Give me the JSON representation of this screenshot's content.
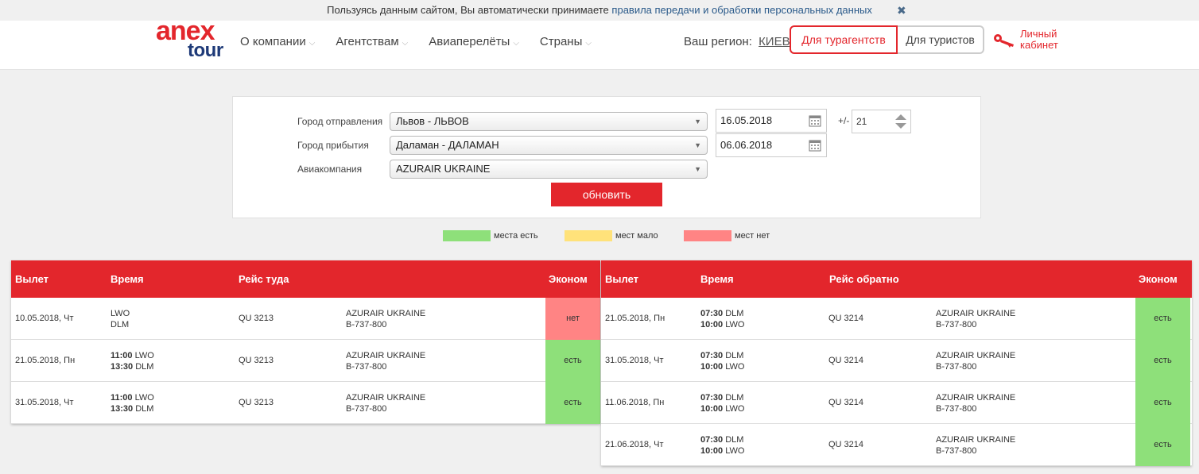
{
  "cookie": {
    "text": "Пользуясь данным сайтом, Вы автоматически принимаете",
    "link": "правила передачи и обработки персональных данных",
    "close": "✖"
  },
  "header": {
    "logo_top": "anex",
    "logo_bottom": "tour",
    "nav": [
      "О компании",
      "Агентствам",
      "Авиаперелёты",
      "Страны"
    ],
    "region_label": "Ваш регион:",
    "region_city": "КИЕВ",
    "btn_agents": "Для турагентств",
    "btn_tourists": "Для туристов",
    "cabinet_line1": "Личный",
    "cabinet_line2": "кабинет",
    "brand_red": "#e3262c",
    "brand_blue": "#1e3a78"
  },
  "search": {
    "departure_label": "Город отправления",
    "departure_value": "Львов - ЛЬВОВ",
    "arrival_label": "Город прибытия",
    "arrival_value": "Даламан - ДАЛАМАН",
    "airline_label": "Авиакомпания",
    "airline_value": "AZURAIR UKRAINE",
    "date_from": "16.05.2018",
    "date_to": "06.06.2018",
    "range_label": "+/-",
    "range_value": "21",
    "update_button": "обновить",
    "calendar_icon": "calendar-icon"
  },
  "legend": [
    {
      "label": "места есть",
      "color": "#8ee07a"
    },
    {
      "label": "мест мало",
      "color": "#ffe27a"
    },
    {
      "label": "мест нет",
      "color": "#ff8484"
    }
  ],
  "outbound": {
    "headers": {
      "date": "Вылет",
      "time": "Время",
      "flight": "Рейс туда",
      "eco": "Эконом"
    },
    "rows": [
      {
        "date": "10.05.2018, Чт",
        "t1": "",
        "p1": "LWO",
        "t2": "",
        "p2": "DLM",
        "flight": "QU 3213",
        "airline": "AZURAIR UKRAINE",
        "plane": "B-737-800",
        "eco": "нет",
        "status": "red"
      },
      {
        "date": "21.05.2018, Пн",
        "t1": "11:00",
        "p1": "LWO",
        "t2": "13:30",
        "p2": "DLM",
        "flight": "QU 3213",
        "airline": "AZURAIR UKRAINE",
        "plane": "B-737-800",
        "eco": "есть",
        "status": "green"
      },
      {
        "date": "31.05.2018, Чт",
        "t1": "11:00",
        "p1": "LWO",
        "t2": "13:30",
        "p2": "DLM",
        "flight": "QU 3213",
        "airline": "AZURAIR UKRAINE",
        "plane": "B-737-800",
        "eco": "есть",
        "status": "green"
      }
    ]
  },
  "inbound": {
    "headers": {
      "date": "Вылет",
      "time": "Время",
      "flight": "Рейс обратно",
      "eco": "Эконом"
    },
    "rows": [
      {
        "date": "21.05.2018, Пн",
        "t1": "07:30",
        "p1": "DLM",
        "t2": "10:00",
        "p2": "LWO",
        "flight": "QU 3214",
        "airline": "AZURAIR UKRAINE",
        "plane": "B-737-800",
        "eco": "есть",
        "status": "green"
      },
      {
        "date": "31.05.2018, Чт",
        "t1": "07:30",
        "p1": "DLM",
        "t2": "10:00",
        "p2": "LWO",
        "flight": "QU 3214",
        "airline": "AZURAIR UKRAINE",
        "plane": "B-737-800",
        "eco": "есть",
        "status": "green"
      },
      {
        "date": "11.06.2018, Пн",
        "t1": "07:30",
        "p1": "DLM",
        "t2": "10:00",
        "p2": "LWO",
        "flight": "QU 3214",
        "airline": "AZURAIR UKRAINE",
        "plane": "B-737-800",
        "eco": "есть",
        "status": "green"
      },
      {
        "date": "21.06.2018, Чт",
        "t1": "07:30",
        "p1": "DLM",
        "t2": "10:00",
        "p2": "LWO",
        "flight": "QU 3214",
        "airline": "AZURAIR UKRAINE",
        "plane": "B-737-800",
        "eco": "есть",
        "status": "green"
      }
    ]
  }
}
